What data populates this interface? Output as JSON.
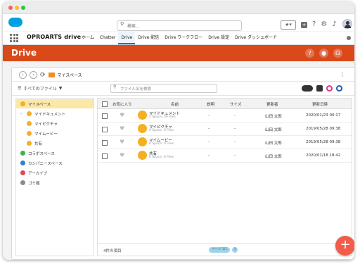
{
  "window": {
    "title": ""
  },
  "global_header": {
    "search_placeholder": "検索...",
    "icons": [
      "favorites-star-icon",
      "add-icon",
      "help-icon",
      "settings-icon",
      "notifications-bell-icon"
    ]
  },
  "nav": {
    "app_name": "OPROARTS drive",
    "tabs": [
      {
        "label": "ホーム",
        "active": false
      },
      {
        "label": "Chatter",
        "active": false
      },
      {
        "label": "Drive",
        "active": true
      },
      {
        "label": "Drive 配信",
        "active": false
      },
      {
        "label": "Drive ワークフロー",
        "active": false
      },
      {
        "label": "Drive 設定",
        "active": false
      },
      {
        "label": "Drive ダッシュボード",
        "active": false
      }
    ]
  },
  "drive_band": {
    "brand": "Drive",
    "accent": "#d9491a"
  },
  "breadcrumb": {
    "label": "マイスペース"
  },
  "filter": {
    "dropdown_label": "すべてのファイル",
    "search_placeholder": "ファイル名を検索"
  },
  "sidebar": {
    "items": [
      {
        "label": "マイスペース",
        "selected": true
      },
      {
        "label": "マイドキュメント",
        "selected": false
      },
      {
        "label": "マイピクチャ",
        "selected": false
      },
      {
        "label": "マイムービー",
        "selected": false
      },
      {
        "label": "共有",
        "selected": false
      },
      {
        "label": "コラボスペース",
        "selected": false
      },
      {
        "label": "カンパニースペース",
        "selected": false
      },
      {
        "label": "アーカイブ",
        "selected": false
      },
      {
        "label": "ゴミ箱",
        "selected": false
      }
    ]
  },
  "table": {
    "headers": [
      "お気に入り",
      "名前",
      "説明",
      "サイズ",
      "更新者",
      "更新日時"
    ],
    "rows": [
      {
        "name": "マイドキュメント",
        "sub": "5 Space, 59 Files",
        "desc": "-",
        "size": "-",
        "updater": "山田 太郎",
        "updated": "2020/01/23 00:17"
      },
      {
        "name": "マイピクチャ",
        "sub": "0 Space, 0 Files",
        "desc": "-",
        "size": "-",
        "updater": "山田 太郎",
        "updated": "2019/05/28 09:38"
      },
      {
        "name": "マイムービー",
        "sub": "0 Space, 0 Files",
        "desc": "-",
        "size": "-",
        "updater": "山田 太郎",
        "updated": "2019/05/28 09:38"
      },
      {
        "name": "共有",
        "sub": "0 Space, 0 Files",
        "desc": "-",
        "size": "-",
        "updater": "山田 太郎",
        "updated": "2020/01/18 18:42"
      }
    ],
    "count_label": "4件の項目",
    "pager": {
      "page_label": "ページ 1/1",
      "page_number": "1"
    }
  }
}
